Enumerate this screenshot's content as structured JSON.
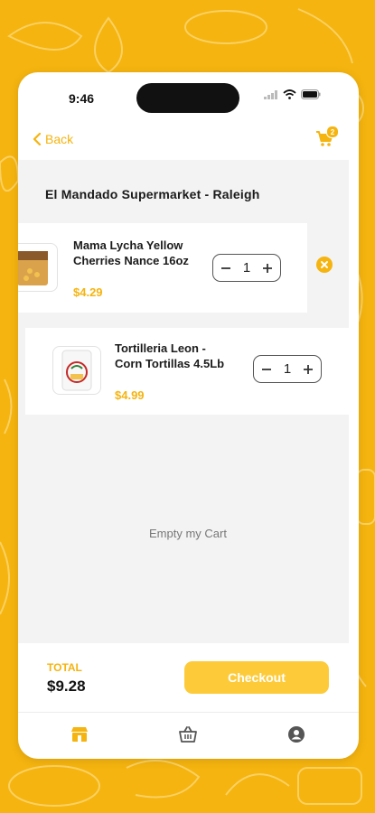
{
  "status_bar": {
    "time": "9:46"
  },
  "nav": {
    "back_label": "Back",
    "cart_count": "2"
  },
  "cart": {
    "store_name": "El Mandado Supermarket - Raleigh",
    "items": [
      {
        "name": "Mama Lycha Yellow Cherries Nance 16oz",
        "price": "$4.29",
        "quantity": "1"
      },
      {
        "name": "Tortilleria Leon - Corn Tortillas 4.5Lb",
        "price": "$4.99",
        "quantity": "1"
      }
    ],
    "empty_label": "Empty my Cart"
  },
  "footer": {
    "total_label": "TOTAL",
    "total_value": "$9.28",
    "checkout_label": "Checkout"
  },
  "tabs": [
    "store-icon",
    "basket-icon",
    "account-icon"
  ],
  "colors": {
    "accent": "#F5B40F",
    "checkout": "#FDCB3A",
    "background": "#F5B40F"
  }
}
